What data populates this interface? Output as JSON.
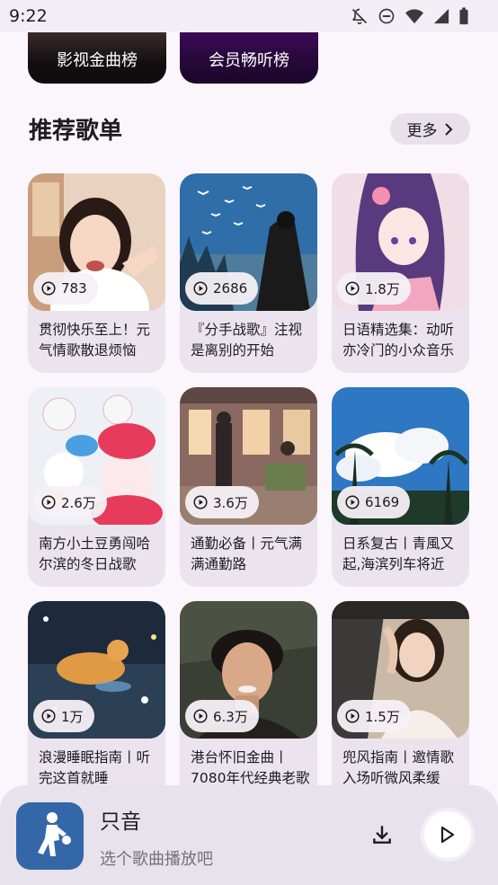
{
  "status_bar": {
    "time": "9:22"
  },
  "top_cards": [
    {
      "label": "影视金曲榜"
    },
    {
      "label": "会员畅听榜"
    }
  ],
  "section": {
    "title": "推荐歌单",
    "more_label": "更多"
  },
  "playlists": [
    {
      "plays": "783",
      "title": "贯彻快乐至上！元气情歌散退烦恼"
    },
    {
      "plays": "2686",
      "title": "『分手战歌』注视是离别的开始"
    },
    {
      "plays": "1.8万",
      "title": "日语精选集：动听亦冷门的小众音乐"
    },
    {
      "plays": "2.6万",
      "title": "南方小土豆勇闯哈尔滨的冬日战歌"
    },
    {
      "plays": "3.6万",
      "title": "通勤必备丨元气满满通勤路"
    },
    {
      "plays": "6169",
      "title": "日系复古丨青風又起,海滨列车将近"
    },
    {
      "plays": "1万",
      "title": "浪漫睡眠指南丨听完这首就睡"
    },
    {
      "plays": "6.3万",
      "title": "港台怀旧金曲丨7080年代经典老歌"
    },
    {
      "plays": "1.5万",
      "title": "兜风指南丨邀情歌入场听微风柔缓"
    }
  ],
  "player": {
    "title": "只音",
    "subtitle": "选个歌曲播放吧"
  }
}
